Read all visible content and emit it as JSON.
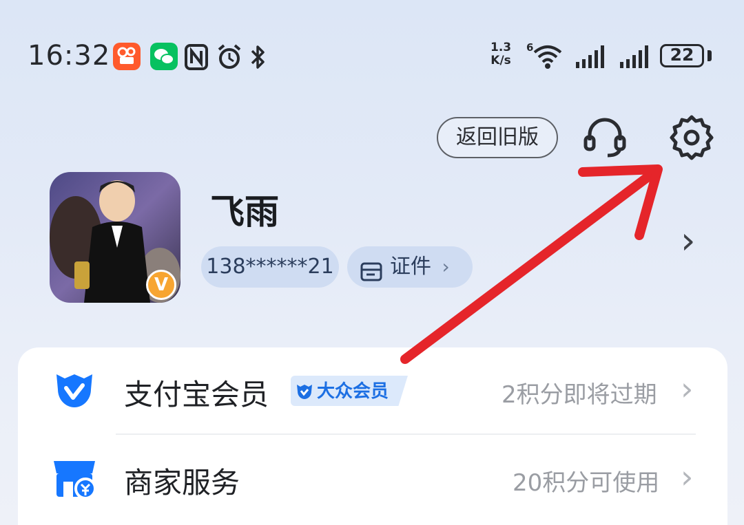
{
  "status_bar": {
    "time": "16:32",
    "netspeed_value": "1.3",
    "netspeed_unit": "K/s",
    "wifi_badge": "6",
    "battery": "22",
    "app_icons": [
      "kuaishou-icon",
      "wechat-icon",
      "nfc-icon",
      "alarm-icon",
      "bluetooth-icon"
    ]
  },
  "header": {
    "old_version_label": "返回旧版",
    "icons": [
      "headset-icon",
      "gear-icon"
    ]
  },
  "profile": {
    "name": "飞雨",
    "phone": "138******21",
    "cert_label": "证件",
    "cert_chevron": "›",
    "row_chevron": "›",
    "badge": "V"
  },
  "menu": {
    "items": [
      {
        "label": "支付宝会员",
        "tag": "大众会员",
        "right_text": "2积分即将过期",
        "chevron": "›",
        "icon": "alipay-member-icon"
      },
      {
        "label": "商家服务",
        "right_text": "20积分可使用",
        "chevron": "›",
        "icon": "merchant-store-icon"
      }
    ]
  },
  "colors": {
    "accent": "#1677ff",
    "annotation_arrow": "#e5252a"
  }
}
